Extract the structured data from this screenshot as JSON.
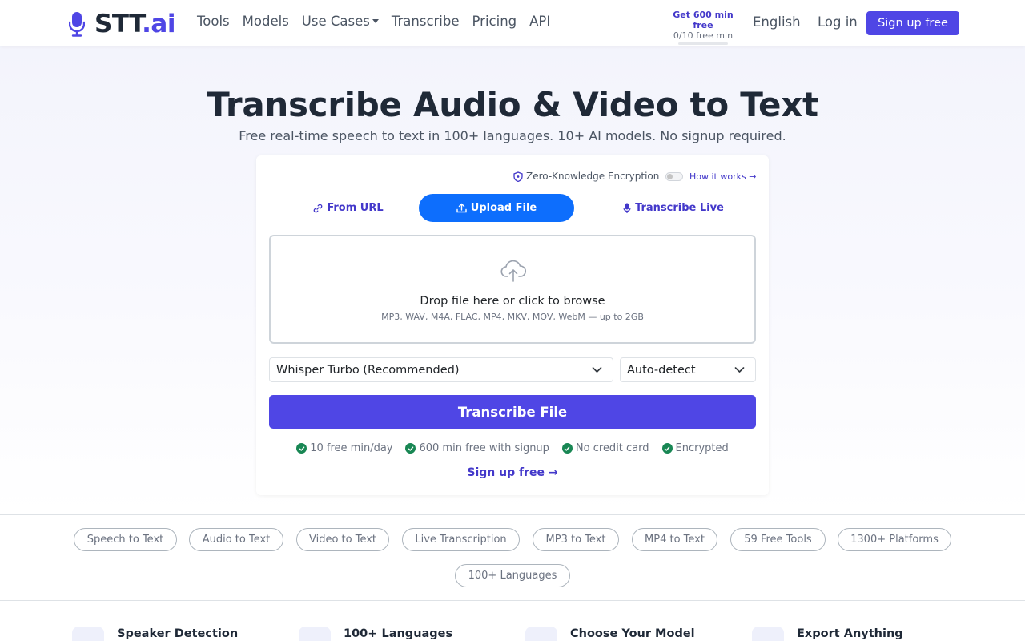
{
  "header": {
    "brand_main": "STT",
    "brand_accent": ".ai",
    "nav": [
      {
        "label": "Tools"
      },
      {
        "label": "Models"
      },
      {
        "label": "Use Cases"
      },
      {
        "label": "Transcribe"
      },
      {
        "label": "Pricing"
      },
      {
        "label": "API"
      }
    ],
    "promo_title": "Get 600 min free",
    "promo_sub": "0/10 free min",
    "language": "English",
    "login": "Log in",
    "signup": "Sign up free"
  },
  "hero": {
    "title": "Transcribe Audio & Video to Text",
    "subtitle": "Free real-time speech to text in 100+ languages. 10+ AI models. No signup required."
  },
  "card": {
    "encryption_label": "Zero-Knowledge Encryption",
    "encryption_enabled": false,
    "how_it_works": "How it works →",
    "tabs": {
      "url": "From URL",
      "upload": "Upload File",
      "live": "Transcribe Live"
    },
    "active_tab": "upload",
    "drop_title": "Drop file here or click to browse",
    "drop_formats": "MP3, WAV, M4A, FLAC, MP4, MKV, MOV, WebM — up to 2GB",
    "model_select": "Whisper Turbo (Recommended)",
    "language_select": "Auto-detect",
    "transcribe_button": "Transcribe File",
    "features": [
      "10 free min/day",
      "600 min free with signup",
      "No credit card",
      "Encrypted"
    ],
    "signup_link": "Sign up free →"
  },
  "pills": [
    "Speech to Text",
    "Audio to Text",
    "Video to Text",
    "Live Transcription",
    "MP3 to Text",
    "MP4 to Text",
    "59 Free Tools",
    "1300+ Platforms",
    "100+ Languages"
  ],
  "feature_row": [
    {
      "title": "Speaker Detection",
      "icon": "users-icon"
    },
    {
      "title": "100+ Languages",
      "icon": "globe-icon"
    },
    {
      "title": "Choose Your Model",
      "icon": "cpu-icon"
    },
    {
      "title": "Export Anything",
      "icon": "file-export-icon"
    }
  ],
  "colors": {
    "brand": "#4f46e5",
    "active_tab": "#0d6efd",
    "check": "#198754",
    "link": "#4338ca"
  }
}
